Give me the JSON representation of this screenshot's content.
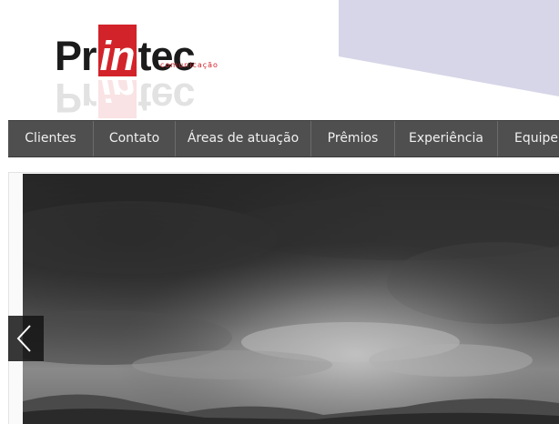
{
  "logo": {
    "part_pr": "Pr",
    "part_in": "in",
    "part_tec": "tec",
    "subtitle": "comunicação",
    "brand_red": "#d2232a",
    "brand_dark": "#1b1b1b"
  },
  "nav": {
    "items": [
      {
        "label": "Clientes"
      },
      {
        "label": "Contato"
      },
      {
        "label": "Áreas de atuação"
      },
      {
        "label": "Prêmios"
      },
      {
        "label": "Experiência"
      },
      {
        "label": "Equipe"
      }
    ],
    "background": "#4f4f4f"
  },
  "slider": {
    "image": "grayscale-stormy-sky",
    "prev_icon": "chevron-left-icon"
  },
  "colors": {
    "header_accent": "#d6d6e8"
  }
}
